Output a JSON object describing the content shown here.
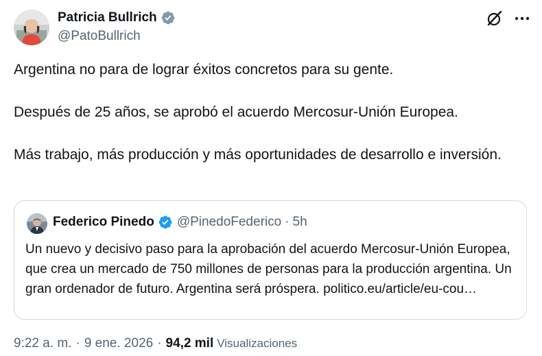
{
  "author": {
    "name": "Patricia Bullrich",
    "handle": "@PatoBullrich",
    "verified": true
  },
  "tweet": {
    "paragraphs": [
      "Argentina no para de lograr éxitos concretos para su gente.",
      "Después de 25 años, se aprobó el acuerdo Mercosur-Unión Europea.",
      "Más trabajo, más producción y más oportunidades de desarrollo e inversión."
    ]
  },
  "quote": {
    "name": "Federico Pinedo",
    "handle": "@PinedoFederico",
    "dot": "·",
    "time": "5h",
    "verified": true,
    "text": "Un nuevo y decisivo paso para la aprobación del acuerdo Mercosur-Unión Europea, que crea un mercado de 750 millones de personas para la producción argentina. Un gran ordenador de futuro. Argentina será próspera. politico.eu/article/eu-cou…"
  },
  "meta": {
    "time": "9:22 a. m.",
    "dot1": "·",
    "date": "9 ene. 2026",
    "dot2": "·",
    "views_count": "94,2 mil",
    "views_label": "Visualizaciones"
  },
  "icons": {
    "verified": "verified-badge-icon",
    "grok": "grok-icon",
    "more": "more-options-icon"
  },
  "colors": {
    "verified_blue": "#1d9bf0",
    "secondary_text": "#536471",
    "primary_text": "#0f1419",
    "border": "#cfd9de"
  }
}
